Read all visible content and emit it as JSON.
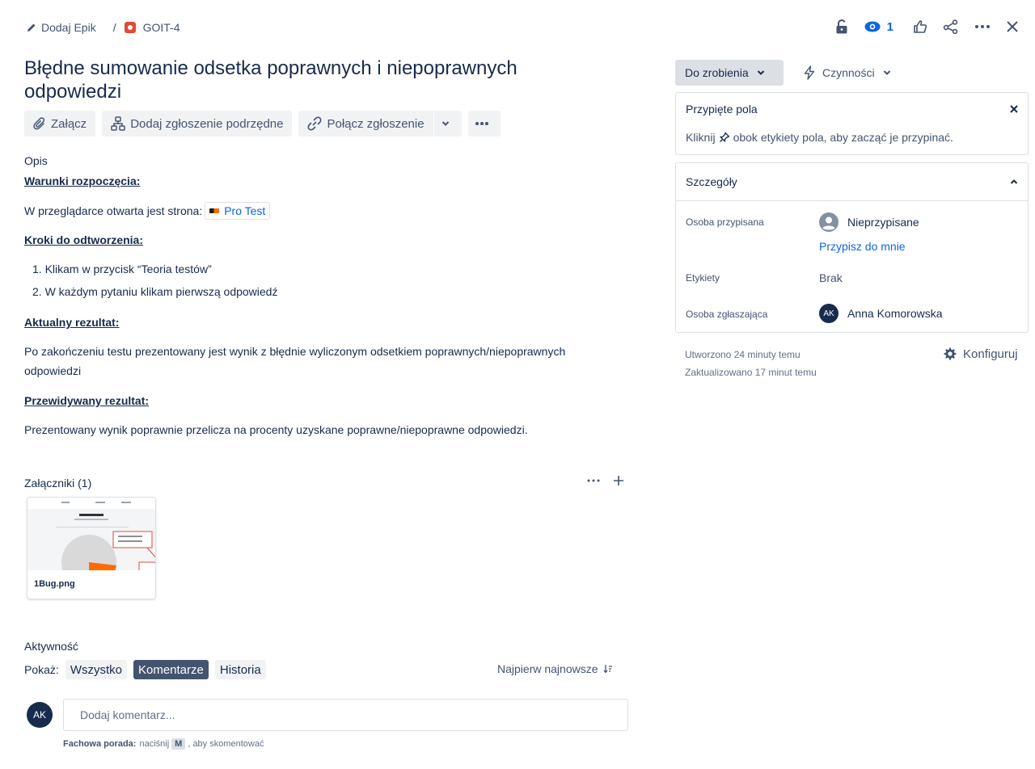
{
  "breadcrumb": {
    "epic_label": "Dodaj Epik",
    "separator": "/",
    "issue_key": "GOIT-4"
  },
  "header": {
    "watch_count": "1"
  },
  "issue": {
    "title": "Błędne sumowanie odsetka poprawnych i niepoprawnych odpowiedzi"
  },
  "toolbar": {
    "attach": "Załącz",
    "add_child": "Dodaj zgłoszenie podrzędne",
    "link_issue": "Połącz zgłoszenie"
  },
  "description": {
    "label": "Opis",
    "preconditions_heading": "Warunki rozpoczęcia:",
    "preconditions_text": "W przeglądarce otwarta jest strona:",
    "preconditions_link": "Pro Test",
    "steps_heading": "Kroki do odtworzenia:",
    "steps": [
      "Klikam w przycisk “Teoria testów”",
      "W każdym pytaniu klikam pierwszą odpowiedź"
    ],
    "actual_heading": "Aktualny rezultat:",
    "actual_text": "Po zakończeniu testu prezentowany jest wynik z błędnie wyliczonym odsetkiem poprawnych/niepoprawnych odpowiedzi",
    "expected_heading": "Przewidywany rezultat:",
    "expected_text": "Prezentowany wynik poprawnie przelicza na procenty uzyskane poprawne/niepoprawne odpowiedzi."
  },
  "attachments": {
    "heading": "Załączniki (1)",
    "file_name": "1Bug.png"
  },
  "activity": {
    "heading": "Aktywność",
    "show_label": "Pokaż:",
    "filters": [
      "Wszystko",
      "Komentarze",
      "Historia"
    ],
    "active_filter": "Komentarze",
    "sort_label": "Najpierw najnowsze",
    "avatar_initials": "AK",
    "comment_placeholder": "Dodaj komentarz...",
    "tip_bold": "Fachowa porada:",
    "tip_text_before": "naciśnij",
    "tip_key": "M",
    "tip_text_after": ", aby skomentować"
  },
  "sidebar": {
    "status": "Do zrobienia",
    "actions": "Czynności",
    "pinned": {
      "title": "Przypięte pola",
      "hint_before": "Kliknij",
      "hint_after": "obok etykiety pola, aby zacząć je przypinać."
    },
    "details": {
      "title": "Szczegóły",
      "assignee_label": "Osoba przypisana",
      "assignee_value": "Nieprzypisane",
      "assign_me": "Przypisz do mnie",
      "labels_label": "Etykiety",
      "labels_value": "Brak",
      "reporter_label": "Osoba zgłaszająca",
      "reporter_initials": "AK",
      "reporter_value": "Anna Komorowska"
    },
    "created": "Utworzono 24 minuty temu",
    "updated": "Zaktualizowano 17 minut temu",
    "configure": "Konfiguruj"
  },
  "colors": {
    "primary_text": "#172b4d",
    "link": "#0c66e4",
    "bug_red": "#e34935",
    "active_filter_bg": "#44546f"
  },
  "icons": [
    "pencil-icon",
    "bug-icon",
    "lock-icon",
    "eye-icon",
    "thumbs-up-icon",
    "share-icon",
    "more-icon",
    "close-icon",
    "paperclip-icon",
    "hierarchy-icon",
    "link-icon",
    "chevron-down-icon",
    "lightning-icon",
    "pin-icon",
    "chevron-up-icon",
    "user-icon",
    "gear-icon",
    "plus-icon",
    "sort-icon"
  ]
}
